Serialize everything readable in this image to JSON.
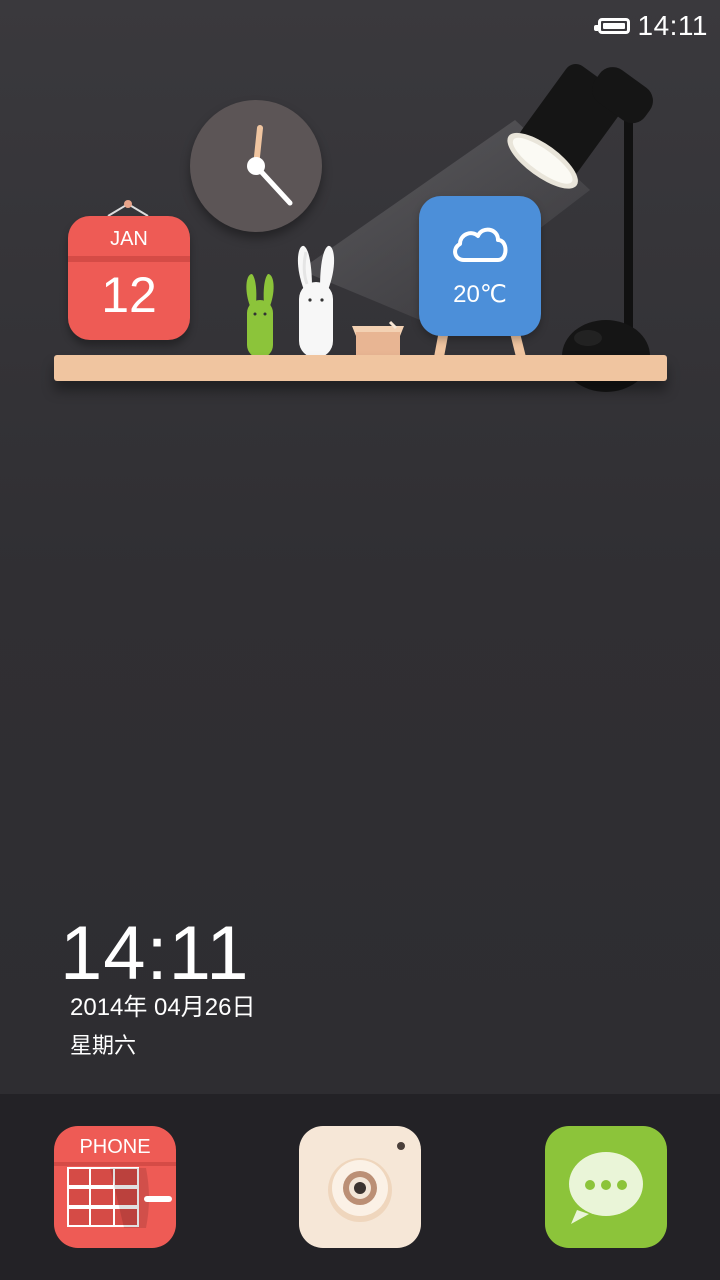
{
  "status_bar": {
    "time": "14:11",
    "battery_icon": "battery-full-icon"
  },
  "widgets": {
    "calendar": {
      "month": "JAN",
      "day": "12"
    },
    "weather": {
      "temperature": "20℃",
      "icon": "cloud-icon"
    },
    "clock": {
      "icon": "analog-clock-icon"
    }
  },
  "lockscreen": {
    "time": "14:11",
    "date": "2014年  04月26日",
    "weekday": "星期六"
  },
  "dock": {
    "apps": [
      {
        "name": "phone",
        "label": "PHONE",
        "color": "#ee5b55"
      },
      {
        "name": "camera",
        "color": "#f6e7d7"
      },
      {
        "name": "messages",
        "color": "#8cc43a"
      }
    ]
  },
  "colors": {
    "background": "#333236",
    "shelf": "#f0c5a0",
    "calendar": "#ee5b55",
    "weather": "#4c8fd9",
    "clock_face": "#5c5556"
  }
}
